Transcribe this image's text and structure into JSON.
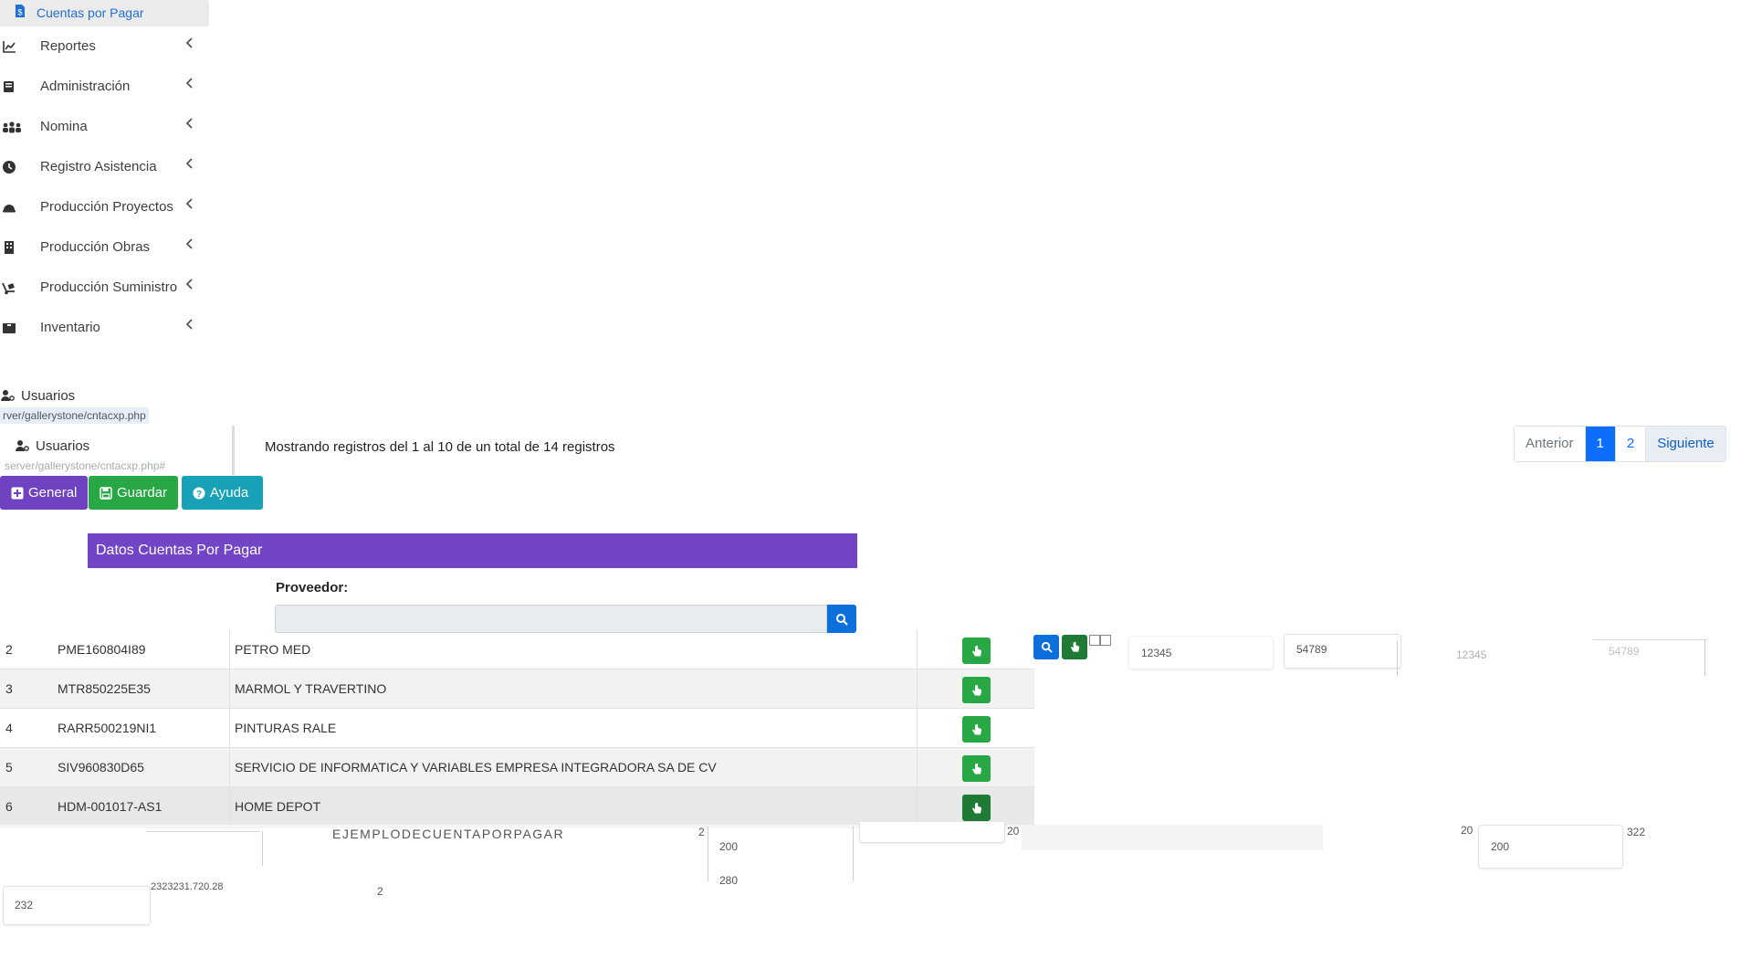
{
  "sidebar": {
    "active_item": {
      "label": "Cuentas por Pagar",
      "icon": "file-dollar-icon"
    },
    "items": [
      {
        "label": "Reportes",
        "icon": "chart-line-icon"
      },
      {
        "label": "Administración",
        "icon": "book-icon"
      },
      {
        "label": "Nomina",
        "icon": "users-icon"
      },
      {
        "label": "Registro Asistencia",
        "icon": "clock-icon"
      },
      {
        "label": "Producción Proyectos",
        "icon": "hard-hat-icon"
      },
      {
        "label": "Producción Obras",
        "icon": "building-icon"
      },
      {
        "label": "Producción Suministro",
        "icon": "truck-loading-icon"
      },
      {
        "label": "Inventario",
        "icon": "box-icon"
      }
    ],
    "user_label": "Usuarios",
    "user_url": "rver/gallerystone/cntacxp.php",
    "user_label_2": "Usuarios",
    "user_url_2": "server/gallerystone/cntacxp.php#"
  },
  "toolbar": {
    "general_label": "General",
    "guardar_label": "Guardar",
    "ayuda_label": "Ayuda"
  },
  "card": {
    "title": "Datos Cuentas Por Pagar",
    "proveedor_label": "Proveedor:",
    "proveedor_value": ""
  },
  "table": {
    "rows": [
      {
        "num": "2",
        "rfc": "PME160804I89",
        "name": "PETRO MED"
      },
      {
        "num": "3",
        "rfc": "MTR850225E35",
        "name": "MARMOL Y TRAVERTINO"
      },
      {
        "num": "4",
        "rfc": "RARR500219NI1",
        "name": "PINTURAS RALE"
      },
      {
        "num": "5",
        "rfc": "SIV960830D65",
        "name": "SERVICIO DE INFORMATICA Y VARIABLES EMPRESA INTEGRADORA SA DE CV"
      },
      {
        "num": "6",
        "rfc": "HDM-001017-AS1",
        "name": "HOME DEPOT"
      }
    ]
  },
  "pagination": {
    "info": "Mostrando registros del 1 al 10 de un total de 14 registros",
    "prev": "Anterior",
    "pages": [
      "1",
      "2"
    ],
    "current": "1",
    "next": "Siguiente"
  },
  "fragments": {
    "v12345_a": "12345",
    "v54789_a": "54789",
    "v12345_b": "12345",
    "v54789_b": "54789",
    "ejemplo": "EJEMPLODECUENTAPORPAGAR",
    "v200_a": "200",
    "v280": "280",
    "v200_b": "200",
    "v20_a": "20",
    "v20_b": "20",
    "v2_a": "2",
    "v2_b": "2",
    "v232": "232",
    "v232321": "2323231.720.28",
    "v322": "322"
  },
  "colors": {
    "purple": "#6f42c1",
    "green": "#28a745",
    "teal": "#17a2b8",
    "blue": "#0d6efd"
  }
}
